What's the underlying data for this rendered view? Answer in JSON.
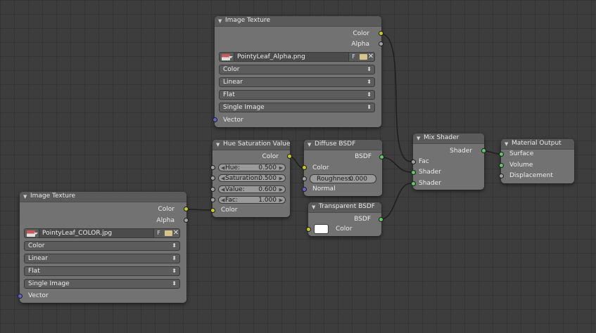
{
  "colors": {
    "background": "#3d3d3d",
    "node_body": "#727272",
    "node_header": "#5a5a5a",
    "socket_color": "#c7c729",
    "socket_shader": "#63c763",
    "socket_value": "#a1a1a1",
    "socket_vector": "#6363c7",
    "link": "#1f1f1f"
  },
  "nodes": {
    "image_texture_alpha": {
      "title": "Image Texture",
      "outputs": [
        "Color",
        "Alpha"
      ],
      "image_name": "PointyLeaf_Alpha.png",
      "fake_user_label": "F",
      "dropdowns": [
        "Color",
        "Linear",
        "Flat",
        "Single Image"
      ],
      "input": "Vector"
    },
    "image_texture_color": {
      "title": "Image Texture",
      "outputs": [
        "Color",
        "Alpha"
      ],
      "image_name": "PointyLeaf_COLOR.jpg",
      "fake_user_label": "F",
      "dropdowns": [
        "Color",
        "Linear",
        "Flat",
        "Single Image"
      ],
      "input": "Vector"
    },
    "hue_saturation": {
      "title": "Hue Saturation Value",
      "output": "Color",
      "sliders": [
        {
          "label": "Hue:",
          "value": "0.500"
        },
        {
          "label": "Saturation:",
          "value": "0.500"
        },
        {
          "label": "Value:",
          "value": "0.600"
        },
        {
          "label": "Fac:",
          "value": "1.000"
        }
      ],
      "input": "Color"
    },
    "diffuse_bsdf": {
      "title": "Diffuse BSDF",
      "output": "BSDF",
      "input_color": "Color",
      "roughness_label": "Roughness:",
      "roughness_value": "0.000",
      "input_normal": "Normal"
    },
    "transparent_bsdf": {
      "title": "Transparent BSDF",
      "output": "BSDF",
      "input_color": "Color",
      "swatch_color": "#ffffff"
    },
    "mix_shader": {
      "title": "Mix Shader",
      "output": "Shader",
      "inputs": [
        "Fac",
        "Shader",
        "Shader"
      ]
    },
    "material_output": {
      "title": "Material Output",
      "inputs": [
        "Surface",
        "Volume",
        "Displacement"
      ]
    }
  }
}
